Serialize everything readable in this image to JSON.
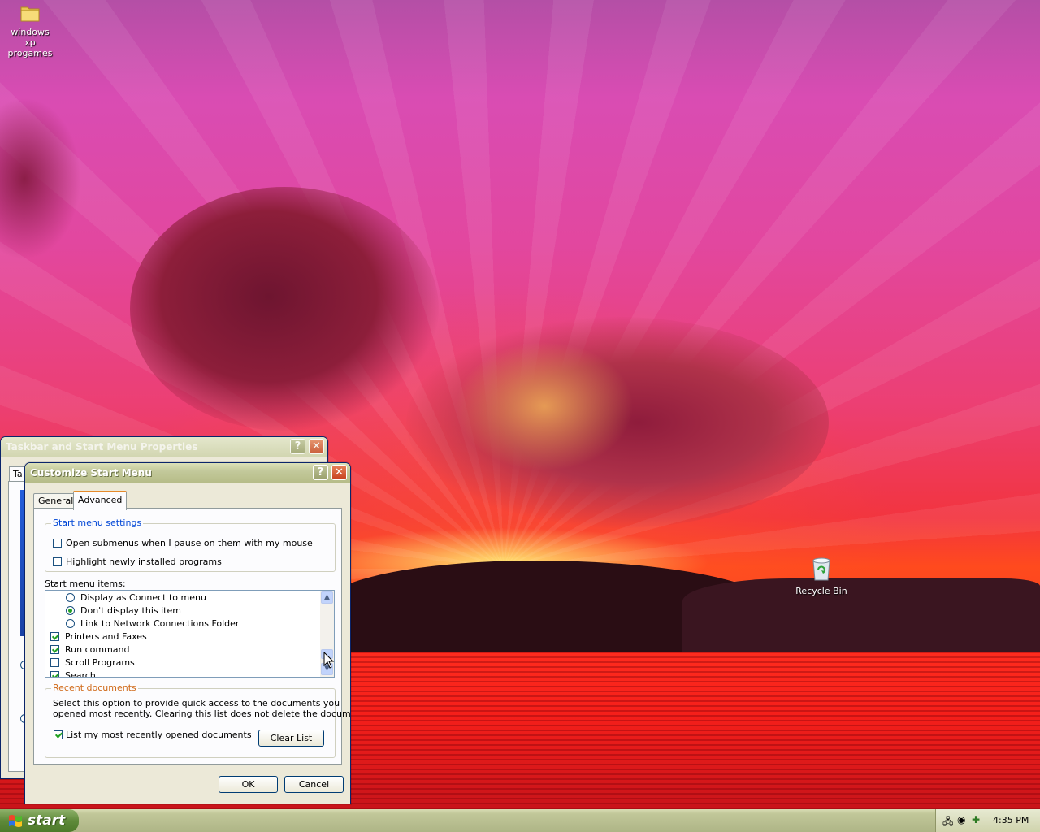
{
  "desktop": {
    "icons": [
      {
        "label_line1": "windows xp",
        "label_line2": "progames"
      },
      {
        "label_line1": "Recycle Bin"
      }
    ]
  },
  "taskbar_props": {
    "title": "Taskbar and Start Menu Properties",
    "tab_partial": "Ta"
  },
  "customize": {
    "title": "Customize Start Menu",
    "tabs": [
      "General",
      "Advanced"
    ],
    "start_menu_settings": {
      "title": "Start menu settings",
      "options": [
        {
          "label": "Open submenus when I pause on them with my mouse",
          "checked": false
        },
        {
          "label": "Highlight newly installed programs",
          "checked": false
        }
      ]
    },
    "items_label": "Start menu items:",
    "items": [
      {
        "type": "radio",
        "label": "Display as Connect to menu",
        "selected": false
      },
      {
        "type": "radio",
        "label": "Don't display this item",
        "selected": true
      },
      {
        "type": "radio",
        "label": "Link to Network Connections Folder",
        "selected": false
      },
      {
        "type": "check",
        "label": "Printers and Faxes",
        "checked": true
      },
      {
        "type": "check",
        "label": "Run command",
        "checked": true
      },
      {
        "type": "check",
        "label": "Scroll Programs",
        "checked": false
      },
      {
        "type": "check",
        "label": "Search",
        "checked": true
      }
    ],
    "recent": {
      "title": "Recent documents",
      "desc_line1": "Select this option to provide quick access to the documents you",
      "desc_line2": "opened most recently.  Clearing this list does not delete the documents.",
      "checkbox_label": "List my most recently opened documents",
      "checked": true,
      "clear_label": "Clear List"
    },
    "ok_label": "OK",
    "cancel_label": "Cancel"
  },
  "taskbar": {
    "start_label": "start",
    "clock": "4:35 PM"
  },
  "colors": {
    "group_title": "#0046d5",
    "titlebar": "#b6bc88",
    "check_green": "#21a121"
  }
}
